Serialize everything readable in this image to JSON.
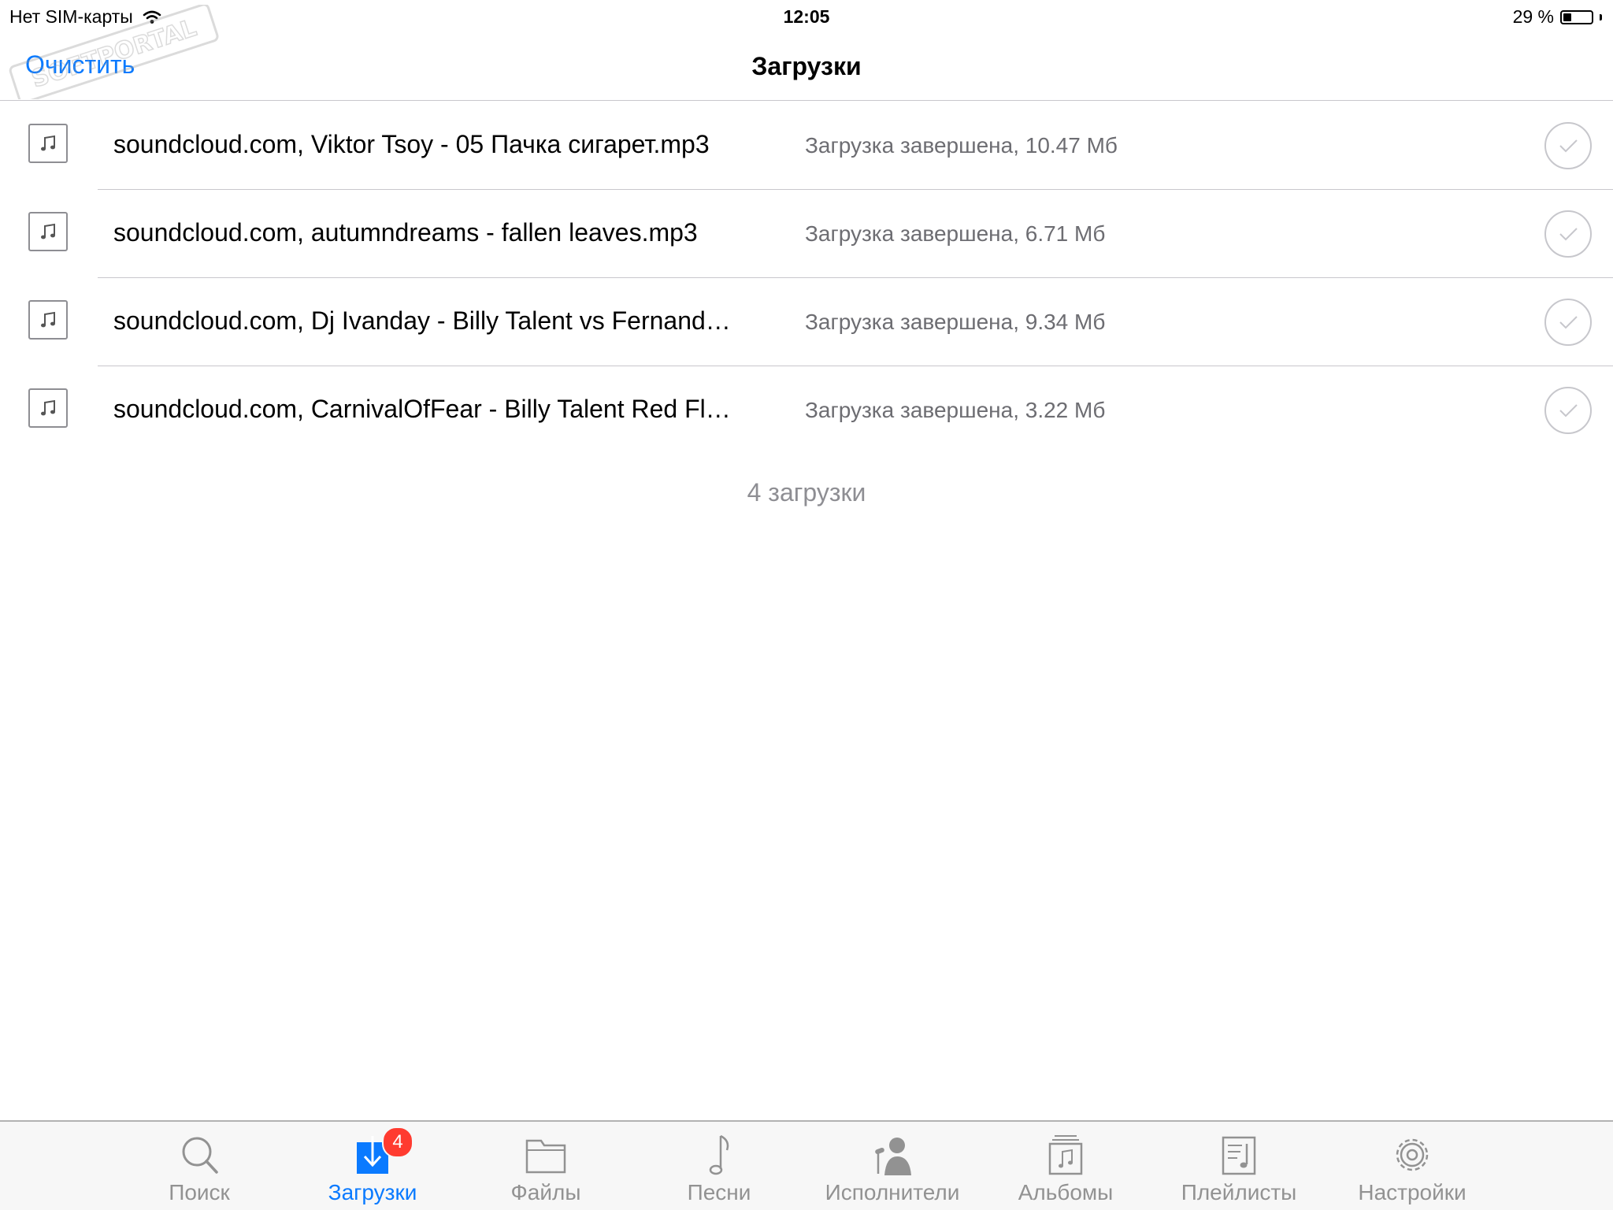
{
  "status_bar": {
    "carrier": "Нет SIM-карты",
    "time": "12:05",
    "battery_text": "29 %",
    "battery_level": 0.29
  },
  "nav": {
    "clear_label": "Очистить",
    "title": "Загрузки"
  },
  "downloads": [
    {
      "title": "soundcloud.com, Viktor Tsoy - 05 Пачка сигарет.mp3",
      "status": "Загрузка завершена, 10.47 Мб"
    },
    {
      "title": "soundcloud.com, autumndreams - fallen leaves.mp3",
      "status": "Загрузка завершена, 6.71 Мб"
    },
    {
      "title": "soundcloud.com, Dj Ivanday - Billy Talent vs Fernand…",
      "status": "Загрузка завершена, 9.34 Мб"
    },
    {
      "title": "soundcloud.com, CarnivalOfFear - Billy Talent Red Fl…",
      "status": "Загрузка завершена, 3.22 Мб"
    }
  ],
  "downloads_count": "4 загрузки",
  "tabs": [
    {
      "label": "Поиск",
      "icon": "search-icon"
    },
    {
      "label": "Загрузки",
      "icon": "download-icon",
      "badge": "4",
      "active": true
    },
    {
      "label": "Файлы",
      "icon": "folder-icon"
    },
    {
      "label": "Песни",
      "icon": "music-note-icon"
    },
    {
      "label": "Исполнители",
      "icon": "artist-icon"
    },
    {
      "label": "Альбомы",
      "icon": "album-icon"
    },
    {
      "label": "Плейлисты",
      "icon": "playlist-icon"
    },
    {
      "label": "Настройки",
      "icon": "gear-icon"
    }
  ],
  "colors": {
    "accent": "#0a7aff",
    "badge": "#ff3b30",
    "secondary_text": "#6d6d72"
  }
}
